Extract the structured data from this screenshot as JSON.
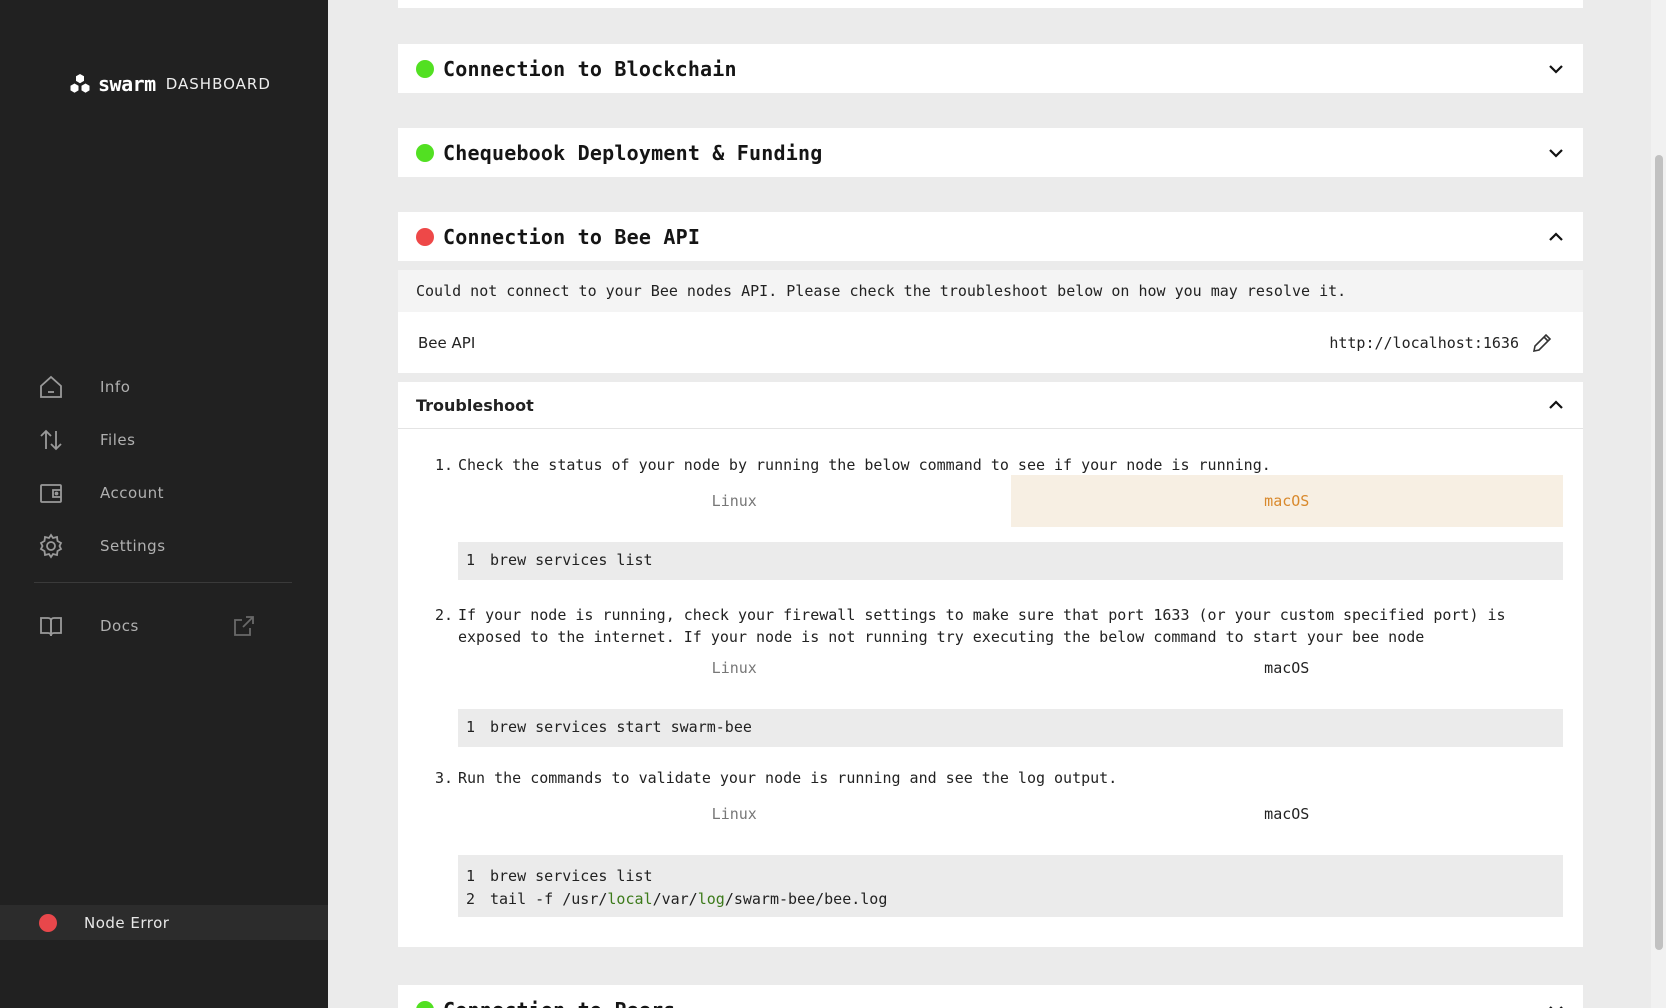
{
  "brand": {
    "word": "swarm",
    "sub": "DASHBOARD"
  },
  "nav": [
    {
      "label": "Info",
      "icon": "home-icon"
    },
    {
      "label": "Files",
      "icon": "transfer-icon"
    },
    {
      "label": "Account",
      "icon": "wallet-icon"
    },
    {
      "label": "Settings",
      "icon": "gear-icon"
    }
  ],
  "docs": {
    "label": "Docs",
    "icon": "book-icon"
  },
  "node_status": {
    "label": "Node Error",
    "color": "#e8474b"
  },
  "sections": {
    "blockchain": "Connection to Blockchain",
    "chequebook": "Chequebook Deployment & Funding",
    "bee_api": "Connection to Bee API",
    "peers": "Connection to Peers"
  },
  "bee_api": {
    "message": "Could not connect to your Bee nodes API. Please check the troubleshoot below on how you may resolve it.",
    "label": "Bee API",
    "value": "http://localhost:1636"
  },
  "troubleshoot": {
    "title": "Troubleshoot",
    "tab_linux": "Linux",
    "tab_macos": "macOS",
    "steps": [
      {
        "num": "1.",
        "text": "Check the status of your node by running the below command to see if your node is running.",
        "code": [
          "brew services list"
        ]
      },
      {
        "num": "2.",
        "text": "If your node is running, check your firewall settings to make sure that port 1633 (or your custom specified port) is exposed to the internet. If your node is not running try executing the below command to start your bee node",
        "code": [
          "brew services start swarm-bee"
        ]
      },
      {
        "num": "3.",
        "text": "Run the commands to validate your node is running and see the log output.",
        "code": [
          "brew services list"
        ]
      }
    ],
    "log_line": {
      "a": "tail -f /usr/",
      "b": "local",
      "c": "/var/",
      "d": "log",
      "e": "/swarm-bee/bee.log"
    }
  },
  "colors": {
    "ok": "#52e022",
    "error": "#ee4848",
    "accent": "#d9892c"
  }
}
